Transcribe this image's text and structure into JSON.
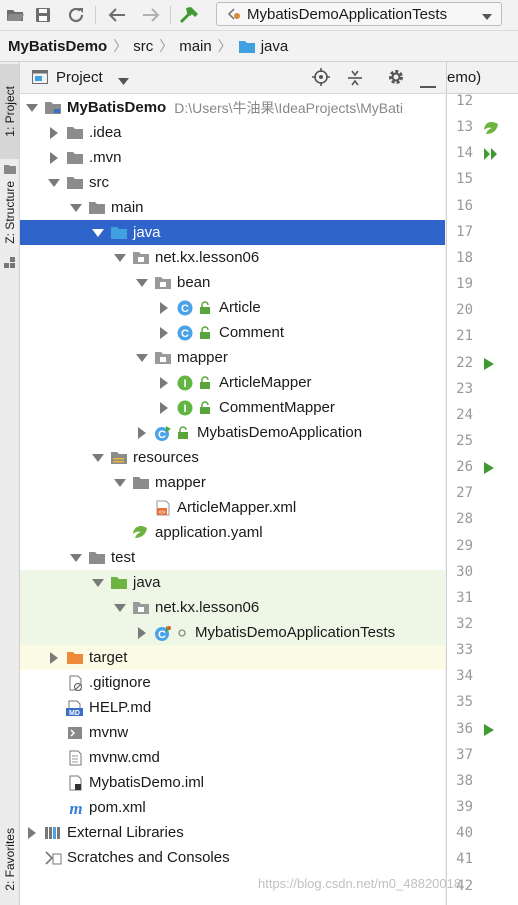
{
  "toolbar": {
    "run_config": "MybatisDemoApplicationTests"
  },
  "breadcrumb": [
    "MyBatisDemo",
    "src",
    "main",
    "java"
  ],
  "left_tabs": {
    "project": "1: Project",
    "structure": "Z: Structure",
    "favorites": "2: Favorites"
  },
  "panel": {
    "title": "Project"
  },
  "tree": [
    {
      "label": "MyBatisDemo",
      "path": "D:\\Users\\牛油果\\IdeaProjects\\MyBati",
      "depth": 0,
      "arrow": "down",
      "icon": "folder-module-icon",
      "bold": true
    },
    {
      "label": ".idea",
      "depth": 1,
      "arrow": "right",
      "icon": "folder-icon"
    },
    {
      "label": ".mvn",
      "depth": 1,
      "arrow": "right",
      "icon": "folder-icon"
    },
    {
      "label": "src",
      "depth": 1,
      "arrow": "down",
      "icon": "folder-icon"
    },
    {
      "label": "main",
      "depth": 2,
      "arrow": "down",
      "icon": "folder-icon"
    },
    {
      "label": "java",
      "depth": 3,
      "arrow": "down",
      "icon": "source-folder-icon",
      "selected": true
    },
    {
      "label": "net.kx.lesson06",
      "depth": 4,
      "arrow": "down",
      "icon": "package-icon"
    },
    {
      "label": "bean",
      "depth": 5,
      "arrow": "down",
      "icon": "package-icon"
    },
    {
      "label": "Article",
      "depth": 6,
      "arrow": "right",
      "icon": "class-icon",
      "lock": true
    },
    {
      "label": "Comment",
      "depth": 6,
      "arrow": "right",
      "icon": "class-icon",
      "lock": true
    },
    {
      "label": "mapper",
      "depth": 5,
      "arrow": "down",
      "icon": "package-icon"
    },
    {
      "label": "ArticleMapper",
      "depth": 6,
      "arrow": "right",
      "icon": "interface-icon",
      "lock": true
    },
    {
      "label": "CommentMapper",
      "depth": 6,
      "arrow": "right",
      "icon": "interface-icon",
      "lock": true
    },
    {
      "label": "MybatisDemoApplication",
      "depth": 5,
      "arrow": "right",
      "icon": "spring-class-icon",
      "lock": true
    },
    {
      "label": "resources",
      "depth": 3,
      "arrow": "down",
      "icon": "resources-folder-icon"
    },
    {
      "label": "mapper",
      "depth": 4,
      "arrow": "down",
      "icon": "folder-icon"
    },
    {
      "label": "ArticleMapper.xml",
      "depth": 5,
      "arrow": "none",
      "icon": "xml-file-icon"
    },
    {
      "label": "application.yaml",
      "depth": 4,
      "arrow": "none",
      "icon": "yaml-file-icon"
    },
    {
      "label": "test",
      "depth": 2,
      "arrow": "down",
      "icon": "folder-icon"
    },
    {
      "label": "java",
      "depth": 3,
      "arrow": "down",
      "icon": "test-folder-icon",
      "test": true
    },
    {
      "label": "net.kx.lesson06",
      "depth": 4,
      "arrow": "down",
      "icon": "package-icon",
      "test": true
    },
    {
      "label": "MybatisDemoApplicationTests",
      "depth": 5,
      "arrow": "right",
      "icon": "spring-test-class-icon",
      "test": true,
      "dot": true
    },
    {
      "label": "target",
      "depth": 1,
      "arrow": "right",
      "icon": "excluded-folder-icon",
      "excluded": true
    },
    {
      "label": ".gitignore",
      "depth": 1,
      "arrow": "none",
      "icon": "gitignore-file-icon"
    },
    {
      "label": "HELP.md",
      "depth": 1,
      "arrow": "none",
      "icon": "markdown-file-icon"
    },
    {
      "label": "mvnw",
      "depth": 1,
      "arrow": "none",
      "icon": "script-file-icon"
    },
    {
      "label": "mvnw.cmd",
      "depth": 1,
      "arrow": "none",
      "icon": "text-file-icon"
    },
    {
      "label": "MybatisDemo.iml",
      "depth": 1,
      "arrow": "none",
      "icon": "iml-file-icon"
    },
    {
      "label": "pom.xml",
      "depth": 1,
      "arrow": "none",
      "icon": "maven-file-icon"
    },
    {
      "label": "External Libraries",
      "depth": 0,
      "arrow": "right",
      "icon": "libraries-icon"
    },
    {
      "label": "Scratches and Consoles",
      "depth": 0,
      "arrow": "none",
      "icon": "scratches-icon"
    }
  ],
  "editor": {
    "tab_label": "emo)",
    "line_numbers": [
      "12",
      "13",
      "14",
      "15",
      "16",
      "17",
      "18",
      "19",
      "20",
      "21",
      "22",
      "23",
      "24",
      "25",
      "26",
      "27",
      "28",
      "29",
      "30",
      "31",
      "32",
      "33",
      "34",
      "35",
      "36",
      "37",
      "38",
      "39",
      "40",
      "41",
      "42"
    ],
    "gutter_marks": [
      {
        "line": "13",
        "icon": "spring-bean-icon"
      },
      {
        "line": "14",
        "icon": "run-all-icon"
      },
      {
        "line": "22",
        "icon": "run-test-icon"
      },
      {
        "line": "26",
        "icon": "run-test-icon"
      },
      {
        "line": "36",
        "icon": "run-test-icon"
      }
    ]
  },
  "watermark": "https://blog.csdn.net/m0_48820018"
}
